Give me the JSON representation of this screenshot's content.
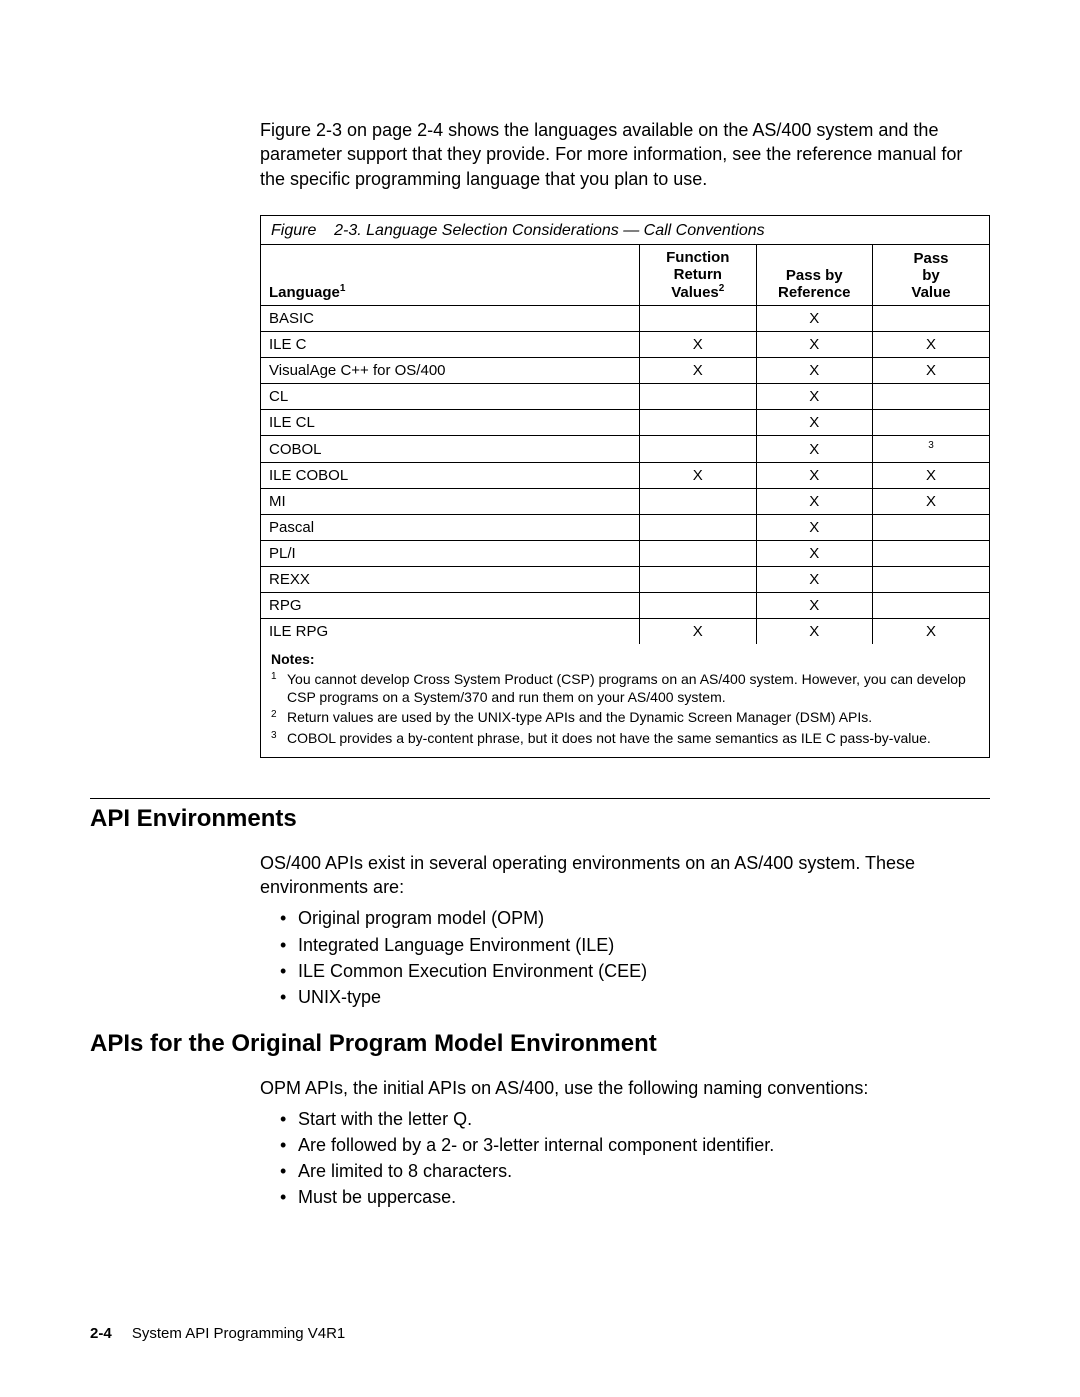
{
  "intro": "Figure 2-3 on page 2-4 shows the languages available on the AS/400 system and the parameter support that they provide. For more information, see the reference manual for the specific programming language that you plan to use.",
  "table": {
    "caption_prefix": "Figure",
    "caption_text": "2-3. Language Selection Considerations — Call Conventions",
    "headers": {
      "lang_label": "Language",
      "lang_sup": "1",
      "frv_l1": "Function",
      "frv_l2": "Return",
      "frv_l3": "Values",
      "frv_sup": "2",
      "pbr_l1": "Pass by",
      "pbr_l2": "Reference",
      "pbv_l1": "Pass",
      "pbv_l2": "by",
      "pbv_l3": "Value"
    },
    "rows": [
      {
        "lang": "BASIC",
        "frv": "",
        "pbr": "X",
        "pbv": ""
      },
      {
        "lang": "ILE C",
        "frv": "X",
        "pbr": "X",
        "pbv": "X"
      },
      {
        "lang": "VisualAge C++ for OS/400",
        "frv": "X",
        "pbr": "X",
        "pbv": "X"
      },
      {
        "lang": "CL",
        "frv": "",
        "pbr": "X",
        "pbv": ""
      },
      {
        "lang": "ILE CL",
        "frv": "",
        "pbr": "X",
        "pbv": ""
      },
      {
        "lang": "COBOL",
        "frv": "",
        "pbr": "X",
        "pbv": "3",
        "pbv_is_sup": true
      },
      {
        "lang": "ILE COBOL",
        "frv": "X",
        "pbr": "X",
        "pbv": "X"
      },
      {
        "lang": "MI",
        "frv": "",
        "pbr": "X",
        "pbv": "X"
      },
      {
        "lang": "Pascal",
        "frv": "",
        "pbr": "X",
        "pbv": ""
      },
      {
        "lang": "PL/I",
        "frv": "",
        "pbr": "X",
        "pbv": ""
      },
      {
        "lang": "REXX",
        "frv": "",
        "pbr": "X",
        "pbv": ""
      },
      {
        "lang": "RPG",
        "frv": "",
        "pbr": "X",
        "pbv": ""
      },
      {
        "lang": "ILE RPG",
        "frv": "X",
        "pbr": "X",
        "pbv": "X"
      }
    ],
    "notes_title": "Notes:",
    "notes": [
      {
        "n": "1",
        "t": "You cannot develop Cross System Product (CSP) programs on an AS/400 system. However, you can develop CSP programs on a System/370 and run them on your AS/400 system."
      },
      {
        "n": "2",
        "t": "Return values are used by the UNIX-type APIs and the Dynamic Screen Manager (DSM) APIs."
      },
      {
        "n": "3",
        "t": "COBOL provides a by-content phrase, but it does not have the same semantics as ILE C pass-by-value."
      }
    ]
  },
  "sections": {
    "env_title": "API Environments",
    "env_text": "OS/400 APIs exist in several operating environments on an AS/400 system. These environments are:",
    "env_bullets": [
      "Original program model (OPM)",
      "Integrated Language Environment (ILE)",
      "ILE Common Execution Environment (CEE)",
      "UNIX-type"
    ],
    "opm_title": "APIs for the Original Program Model Environment",
    "opm_text": "OPM APIs, the initial APIs on AS/400, use the following naming conventions:",
    "opm_bullets": [
      "Start with the letter Q.",
      "Are followed by a 2- or 3-letter internal component identifier.",
      "Are limited to 8 characters.",
      "Must be uppercase."
    ]
  },
  "footer": {
    "page_num": "2-4",
    "doc_title": "System API Programming V4R1"
  }
}
